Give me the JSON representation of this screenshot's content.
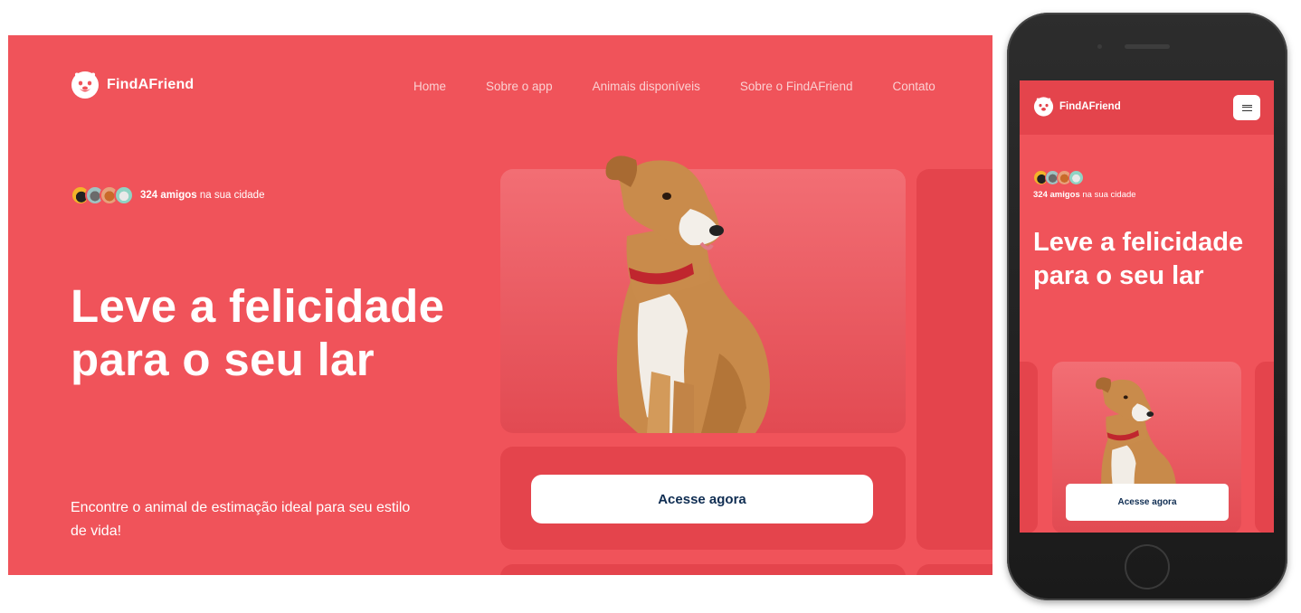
{
  "brand": {
    "name": "FindAFriend",
    "color_primary": "#f0535a",
    "color_panel": "#e4444c",
    "color_button_text": "#0f2d52"
  },
  "nav": {
    "items": [
      {
        "label": "Home"
      },
      {
        "label": "Sobre o app"
      },
      {
        "label": "Animais disponíveis"
      },
      {
        "label": "Sobre o FindAFriend"
      },
      {
        "label": "Contato"
      }
    ]
  },
  "hero": {
    "friends_count": "324 amigos",
    "friends_suffix": " na sua cidade",
    "title": "Leve a felicidade para o seu lar",
    "subtitle": "Encontre o animal de estimação ideal para seu estilo de vida!",
    "cta_label": "Acesse agora",
    "avatars": [
      "black-dog-avatar",
      "gray-cat-avatar",
      "orange-cat-avatar",
      "white-dog-avatar"
    ]
  },
  "mobile": {
    "menu_icon": "hamburger-menu-icon",
    "friends_count": "324 amigos",
    "friends_suffix": " na sua cidade",
    "title": "Leve a felicidade para o seu lar",
    "cta_label": "Acesse agora"
  }
}
